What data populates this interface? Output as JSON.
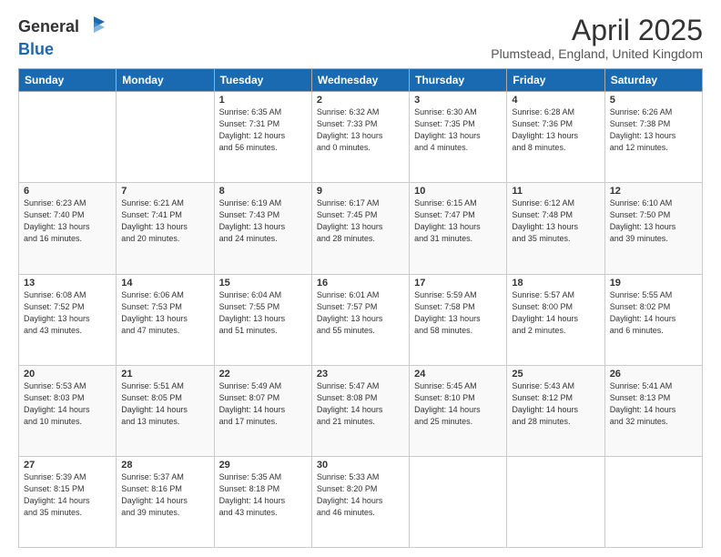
{
  "header": {
    "logo_line1": "General",
    "logo_line2": "Blue",
    "month_year": "April 2025",
    "location": "Plumstead, England, United Kingdom"
  },
  "weekdays": [
    "Sunday",
    "Monday",
    "Tuesday",
    "Wednesday",
    "Thursday",
    "Friday",
    "Saturday"
  ],
  "weeks": [
    [
      {
        "day": "",
        "info": ""
      },
      {
        "day": "",
        "info": ""
      },
      {
        "day": "1",
        "info": "Sunrise: 6:35 AM\nSunset: 7:31 PM\nDaylight: 12 hours\nand 56 minutes."
      },
      {
        "day": "2",
        "info": "Sunrise: 6:32 AM\nSunset: 7:33 PM\nDaylight: 13 hours\nand 0 minutes."
      },
      {
        "day": "3",
        "info": "Sunrise: 6:30 AM\nSunset: 7:35 PM\nDaylight: 13 hours\nand 4 minutes."
      },
      {
        "day": "4",
        "info": "Sunrise: 6:28 AM\nSunset: 7:36 PM\nDaylight: 13 hours\nand 8 minutes."
      },
      {
        "day": "5",
        "info": "Sunrise: 6:26 AM\nSunset: 7:38 PM\nDaylight: 13 hours\nand 12 minutes."
      }
    ],
    [
      {
        "day": "6",
        "info": "Sunrise: 6:23 AM\nSunset: 7:40 PM\nDaylight: 13 hours\nand 16 minutes."
      },
      {
        "day": "7",
        "info": "Sunrise: 6:21 AM\nSunset: 7:41 PM\nDaylight: 13 hours\nand 20 minutes."
      },
      {
        "day": "8",
        "info": "Sunrise: 6:19 AM\nSunset: 7:43 PM\nDaylight: 13 hours\nand 24 minutes."
      },
      {
        "day": "9",
        "info": "Sunrise: 6:17 AM\nSunset: 7:45 PM\nDaylight: 13 hours\nand 28 minutes."
      },
      {
        "day": "10",
        "info": "Sunrise: 6:15 AM\nSunset: 7:47 PM\nDaylight: 13 hours\nand 31 minutes."
      },
      {
        "day": "11",
        "info": "Sunrise: 6:12 AM\nSunset: 7:48 PM\nDaylight: 13 hours\nand 35 minutes."
      },
      {
        "day": "12",
        "info": "Sunrise: 6:10 AM\nSunset: 7:50 PM\nDaylight: 13 hours\nand 39 minutes."
      }
    ],
    [
      {
        "day": "13",
        "info": "Sunrise: 6:08 AM\nSunset: 7:52 PM\nDaylight: 13 hours\nand 43 minutes."
      },
      {
        "day": "14",
        "info": "Sunrise: 6:06 AM\nSunset: 7:53 PM\nDaylight: 13 hours\nand 47 minutes."
      },
      {
        "day": "15",
        "info": "Sunrise: 6:04 AM\nSunset: 7:55 PM\nDaylight: 13 hours\nand 51 minutes."
      },
      {
        "day": "16",
        "info": "Sunrise: 6:01 AM\nSunset: 7:57 PM\nDaylight: 13 hours\nand 55 minutes."
      },
      {
        "day": "17",
        "info": "Sunrise: 5:59 AM\nSunset: 7:58 PM\nDaylight: 13 hours\nand 58 minutes."
      },
      {
        "day": "18",
        "info": "Sunrise: 5:57 AM\nSunset: 8:00 PM\nDaylight: 14 hours\nand 2 minutes."
      },
      {
        "day": "19",
        "info": "Sunrise: 5:55 AM\nSunset: 8:02 PM\nDaylight: 14 hours\nand 6 minutes."
      }
    ],
    [
      {
        "day": "20",
        "info": "Sunrise: 5:53 AM\nSunset: 8:03 PM\nDaylight: 14 hours\nand 10 minutes."
      },
      {
        "day": "21",
        "info": "Sunrise: 5:51 AM\nSunset: 8:05 PM\nDaylight: 14 hours\nand 13 minutes."
      },
      {
        "day": "22",
        "info": "Sunrise: 5:49 AM\nSunset: 8:07 PM\nDaylight: 14 hours\nand 17 minutes."
      },
      {
        "day": "23",
        "info": "Sunrise: 5:47 AM\nSunset: 8:08 PM\nDaylight: 14 hours\nand 21 minutes."
      },
      {
        "day": "24",
        "info": "Sunrise: 5:45 AM\nSunset: 8:10 PM\nDaylight: 14 hours\nand 25 minutes."
      },
      {
        "day": "25",
        "info": "Sunrise: 5:43 AM\nSunset: 8:12 PM\nDaylight: 14 hours\nand 28 minutes."
      },
      {
        "day": "26",
        "info": "Sunrise: 5:41 AM\nSunset: 8:13 PM\nDaylight: 14 hours\nand 32 minutes."
      }
    ],
    [
      {
        "day": "27",
        "info": "Sunrise: 5:39 AM\nSunset: 8:15 PM\nDaylight: 14 hours\nand 35 minutes."
      },
      {
        "day": "28",
        "info": "Sunrise: 5:37 AM\nSunset: 8:16 PM\nDaylight: 14 hours\nand 39 minutes."
      },
      {
        "day": "29",
        "info": "Sunrise: 5:35 AM\nSunset: 8:18 PM\nDaylight: 14 hours\nand 43 minutes."
      },
      {
        "day": "30",
        "info": "Sunrise: 5:33 AM\nSunset: 8:20 PM\nDaylight: 14 hours\nand 46 minutes."
      },
      {
        "day": "",
        "info": ""
      },
      {
        "day": "",
        "info": ""
      },
      {
        "day": "",
        "info": ""
      }
    ]
  ]
}
